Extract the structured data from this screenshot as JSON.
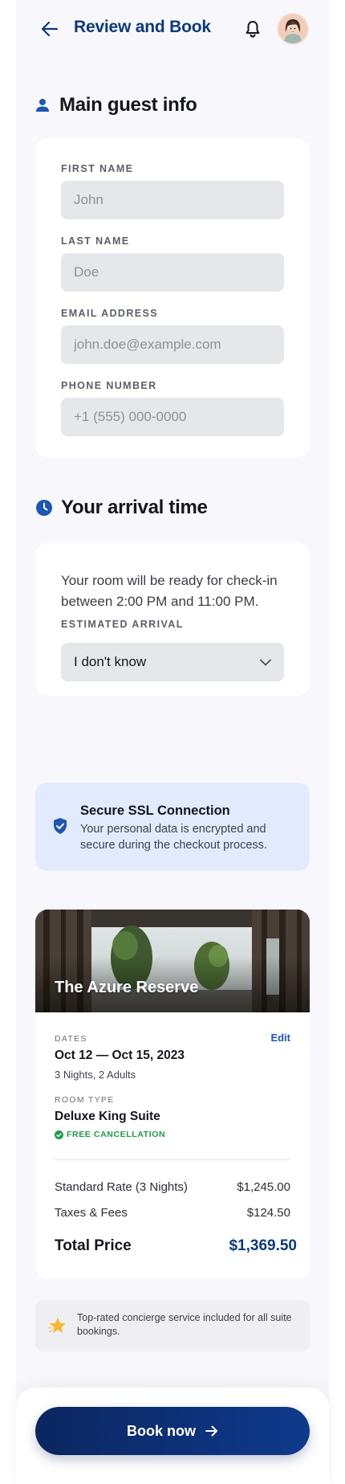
{
  "header": {
    "title": "Review and Book",
    "back_icon": "arrow-left-icon",
    "notification_icon": "bell-icon"
  },
  "guest_info": {
    "title": "Main guest info",
    "icon": "person-icon",
    "fields": [
      {
        "label": "FIRST NAME",
        "placeholder": "John"
      },
      {
        "label": "LAST NAME",
        "placeholder": "Doe"
      },
      {
        "label": "EMAIL ADDRESS",
        "placeholder": "john.doe@example.com"
      },
      {
        "label": "PHONE NUMBER",
        "placeholder": "+1 (555) 000-0000"
      }
    ]
  },
  "arrival": {
    "title": "Your arrival time",
    "icon": "clock-icon",
    "description": "Your room will be ready for check-in between 2:00 PM and 11:00 PM.",
    "select_label": "ESTIMATED ARRIVAL",
    "select_value": "I don't know"
  },
  "ssl": {
    "icon": "shield-check-icon",
    "title": "Secure SSL Connection",
    "text": "Your personal data is encrypted and secure during the checkout process."
  },
  "booking": {
    "hotel_name": "The Azure Reserve",
    "dates_label": "DATES",
    "edit_label": "Edit",
    "dates": "Oct 12 — Oct 15, 2023",
    "guests": "3 Nights, 2 Adults",
    "room_label": "ROOM TYPE",
    "room": "Deluxe King Suite",
    "cancellation": "FREE CANCELLATION",
    "rate_label": "Standard Rate (3 Nights)",
    "rate_value": "$1,245.00",
    "taxes_label": "Taxes & Fees",
    "taxes_value": "$124.50",
    "total_label": "Total Price",
    "total_value": "$1,369.50"
  },
  "concierge": {
    "icon": "star-icon",
    "text": "Top-rated concierge service included for all suite bookings."
  },
  "footer": {
    "book_label": "Book now",
    "arrow_icon": "arrow-right-icon"
  },
  "colors": {
    "brand": "#0b3a7e",
    "accent": "#1d56b3",
    "success": "#1e9a4a",
    "ssl_bg": "#e2ebfd"
  }
}
